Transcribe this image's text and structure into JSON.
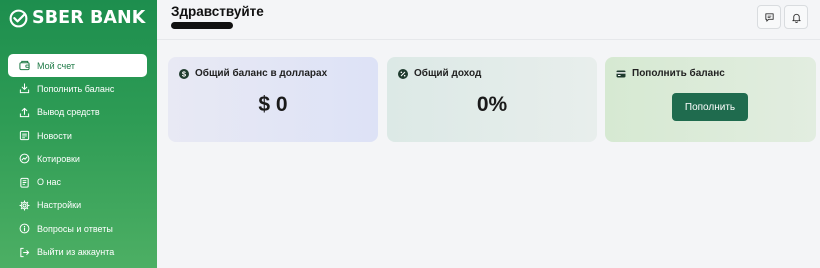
{
  "brand": {
    "name": "SBER BANK",
    "accent": "#21a038"
  },
  "sidebar": {
    "items": [
      {
        "label": "Мой счет",
        "icon": "wallet-icon",
        "active": true
      },
      {
        "label": "Пополнить баланс",
        "icon": "deposit-icon"
      },
      {
        "label": "Вывод средств",
        "icon": "withdraw-icon"
      },
      {
        "label": "Новости",
        "icon": "news-icon"
      },
      {
        "label": "Котировки",
        "icon": "chart-icon"
      },
      {
        "label": "О нас",
        "icon": "document-icon"
      },
      {
        "label": "Настройки",
        "icon": "gear-icon"
      },
      {
        "label": "Вопросы и ответы",
        "icon": "help-icon"
      },
      {
        "label": "Выйти из аккаунта",
        "icon": "logout-icon"
      }
    ]
  },
  "header": {
    "greeting": "Здравствуйте",
    "icons": [
      "chat-icon",
      "bell-icon"
    ]
  },
  "cards": {
    "balance": {
      "title": "Общий баланс в долларах",
      "value": "$ 0",
      "icon": "dollar-icon"
    },
    "income": {
      "title": "Общий доход",
      "value": "0%",
      "icon": "percent-icon"
    },
    "topup": {
      "title": "Пополнить баланс",
      "button": "Пополнить",
      "icon": "card-icon"
    }
  },
  "colors": {
    "sidebar_top": "#1d8e4e",
    "sidebar_bottom": "#4daf64",
    "button": "#1f6b4e"
  }
}
